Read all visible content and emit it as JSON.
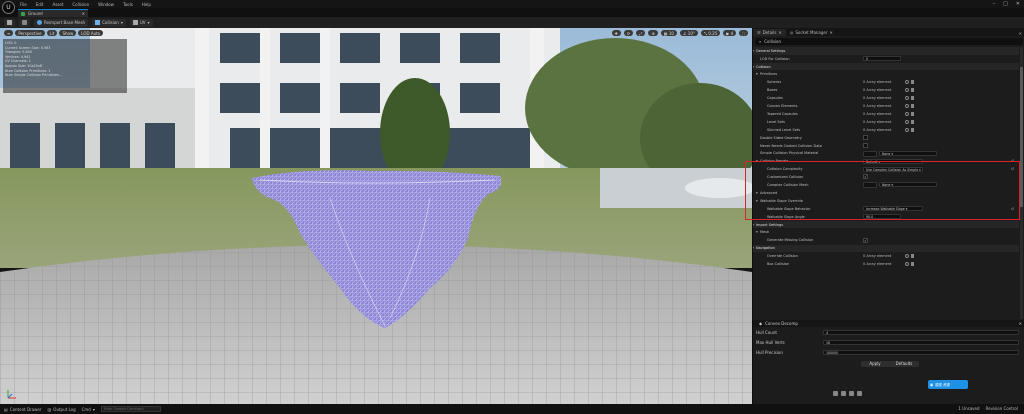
{
  "app": {
    "menu": [
      "File",
      "Edit",
      "Asset",
      "Collision",
      "Window",
      "Tools",
      "Help"
    ],
    "tab_title": "Ground",
    "toolbar": {
      "btn1": "Reimport Base Mesh",
      "btn2": "Collision",
      "btn3": "UV"
    }
  },
  "viewport": {
    "chips": [
      "Perspective",
      "Lit",
      "Show",
      "LOD Auto"
    ],
    "right_chips": [
      "",
      "",
      "",
      "",
      "",
      "",
      "",
      "",
      "",
      ""
    ],
    "stats": [
      "LOD: 0",
      "Current Screen Size: 0.563",
      "Triangles: 9,600",
      "Vertices: 4,941",
      "UV Channels: 1",
      "Approx Size: 10x20x8",
      "Num Collision Primitives: 1",
      "Num Simple Collision Primitives..."
    ]
  },
  "details": {
    "tabs": [
      "Details",
      "Socket Manager"
    ],
    "search": "Collision",
    "rows": [
      {
        "t": "cat",
        "label": "General Settings"
      },
      {
        "t": "prop",
        "label": "LOD For Collision",
        "field": "0"
      },
      {
        "t": "cat",
        "label": "Collision"
      },
      {
        "t": "sub",
        "label": "Primitives"
      },
      {
        "t": "prop2",
        "label": "Spheres",
        "val": "0 Array element"
      },
      {
        "t": "prop2",
        "label": "Boxes",
        "val": "0 Array element"
      },
      {
        "t": "prop2",
        "label": "Capsules",
        "val": "0 Array element"
      },
      {
        "t": "prop2",
        "label": "Convex Elements",
        "val": "0 Array element"
      },
      {
        "t": "prop2",
        "label": "Tapered Capsules",
        "val": "0 Array element"
      },
      {
        "t": "prop2",
        "label": "Level Sets",
        "val": "0 Array element"
      },
      {
        "t": "prop2",
        "label": "Skinned Level Sets",
        "val": "0 Array element"
      },
      {
        "t": "prop",
        "label": "Double Sided Geometry",
        "chk": false
      },
      {
        "t": "prop",
        "label": "Never Needs Cooked Collision Data",
        "chk": false
      },
      {
        "t": "prop",
        "label": "Simple Collision Physical Material",
        "dd": "None"
      },
      {
        "t": "sub",
        "label": "Collision Presets",
        "dd2": "Default"
      },
      {
        "t": "prop2",
        "label": "Collision Complexity",
        "dd2": "Use Complex Collision As Simple"
      },
      {
        "t": "prop2",
        "label": "Customized Collision",
        "chk": true
      },
      {
        "t": "prop2",
        "label": "Complex Collision Mesh",
        "dd": "None"
      },
      {
        "t": "sub",
        "label": "Advanced"
      },
      {
        "t": "sub",
        "label": "Walkable Slope Override"
      },
      {
        "t": "prop2",
        "label": "Walkable Slope Behavior",
        "dd2": "Increase Walkable Slope"
      },
      {
        "t": "prop2",
        "label": "Walkable Slope Angle",
        "field": "90.0"
      },
      {
        "t": "cat",
        "label": "Import Settings"
      },
      {
        "t": "sub",
        "label": "Mesh"
      },
      {
        "t": "prop2",
        "label": "Generate Missing Collision",
        "chk": true
      },
      {
        "t": "cat",
        "label": "Navigation"
      },
      {
        "t": "prop2",
        "label": "Override Collision",
        "val": "0 Array element"
      },
      {
        "t": "prop2",
        "label": "Box Collision",
        "val": "0 Array element"
      }
    ]
  },
  "convex": {
    "title": "Convex Decomp",
    "rows": [
      {
        "label": "Hull Count",
        "val": "4"
      },
      {
        "label": "Max Hull Verts",
        "val": "16"
      },
      {
        "label": "Hull Precision",
        "val": "100000"
      }
    ],
    "apply": "Apply",
    "defaults": "Defaults",
    "badge": "模型 资源"
  },
  "status": {
    "items": [
      "Content Drawer",
      "Output Log",
      "Cmd"
    ],
    "cmd_placeholder": "Enter Console Command",
    "right": [
      "1 Unsaved",
      "Revision Control"
    ]
  },
  "colors": {
    "accent": "#0d84d8",
    "red": "#d8232a",
    "mesh": "#a9a4e8"
  }
}
